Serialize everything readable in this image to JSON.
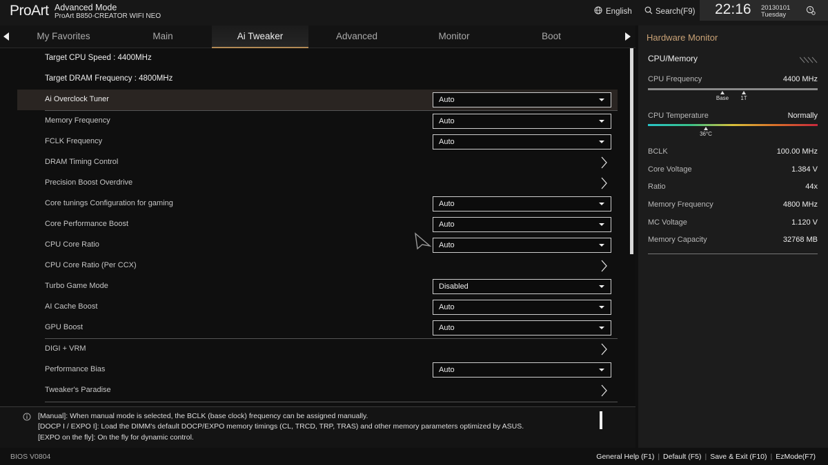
{
  "header": {
    "logo": "ProArt",
    "mode": "Advanced Mode",
    "board": "ProArt B850-CREATOR WIFI NEO",
    "language": "English",
    "search": "Search(F9)",
    "time": "22:16",
    "date": "20130101",
    "day": "Tuesday"
  },
  "tabs": [
    {
      "label": "My Favorites"
    },
    {
      "label": "Main"
    },
    {
      "label": "Ai Tweaker"
    },
    {
      "label": "Advanced"
    },
    {
      "label": "Monitor"
    },
    {
      "label": "Boot"
    }
  ],
  "active_tab": "Ai Tweaker",
  "info": {
    "target_cpu": "Target CPU Speed : 4400MHz",
    "target_dram": "Target DRAM Frequency : 4800MHz"
  },
  "settings": [
    {
      "label": "Ai Overclock Tuner",
      "value": "Auto"
    },
    {
      "label": "Memory Frequency",
      "value": "Auto"
    },
    {
      "label": "FCLK Frequency",
      "value": "Auto"
    },
    {
      "label": "DRAM Timing Control"
    },
    {
      "label": "Precision Boost Overdrive"
    },
    {
      "label": "Core tunings Configuration for gaming",
      "value": "Auto"
    },
    {
      "label": "Core Performance Boost",
      "value": "Auto"
    },
    {
      "label": "CPU Core Ratio",
      "value": "Auto"
    },
    {
      "label": "CPU Core Ratio (Per CCX)"
    },
    {
      "label": "Turbo Game Mode",
      "value": "Disabled"
    },
    {
      "label": "AI Cache Boost",
      "value": "Auto"
    },
    {
      "label": "GPU Boost",
      "value": "Auto"
    },
    {
      "label": "DIGI + VRM"
    },
    {
      "label": "Performance Bias",
      "value": "Auto"
    },
    {
      "label": "Tweaker's Paradise"
    }
  ],
  "help": {
    "line1": "[Manual]: When manual mode is selected, the BCLK (base clock) frequency can be assigned manually.",
    "line2": "[DOCP I / EXPO I]:  Load the DIMM's default DOCP/EXPO memory timings (CL, TRCD, TRP, TRAS) and other memory parameters optimized by ASUS.",
    "line3": "[EXPO on the fly]: On the fly for dynamic control."
  },
  "hardware_monitor": {
    "title": "Hardware Monitor",
    "section": "CPU/Memory",
    "cpu_frequency": {
      "label": "CPU Frequency",
      "value": "4400 MHz",
      "marker_base": "Base",
      "marker_1t": "1T"
    },
    "cpu_temperature": {
      "label": "CPU Temperature",
      "value": "Normally",
      "reading": "36°C"
    },
    "items": [
      {
        "label": "BCLK",
        "value": "100.00 MHz"
      },
      {
        "label": "Core Voltage",
        "value": "1.384 V"
      },
      {
        "label": "Ratio",
        "value": "44x"
      },
      {
        "label": "Memory Frequency",
        "value": "4800 MHz"
      },
      {
        "label": "MC Voltage",
        "value": "1.120 V"
      },
      {
        "label": "Memory Capacity",
        "value": "32768 MB"
      }
    ]
  },
  "footer": {
    "bios_version": "BIOS V0804",
    "links": [
      {
        "label": "General Help (F1)"
      },
      {
        "label": "Default (F5)"
      },
      {
        "label": "Save & Exit (F10)"
      },
      {
        "label": "EzMode(F7)"
      }
    ]
  },
  "colors": {
    "accent": "#b38a55",
    "monitor_title": "#c9a276",
    "selected_row": "#2a2522"
  }
}
